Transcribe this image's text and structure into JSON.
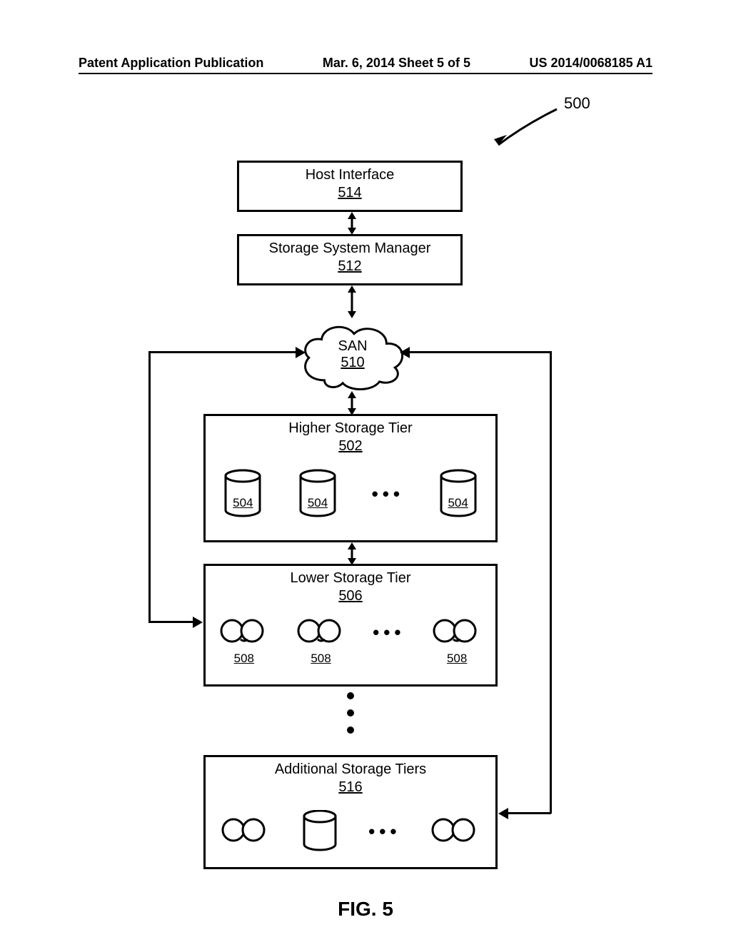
{
  "header": {
    "left": "Patent Application Publication",
    "center": "Mar. 6, 2014  Sheet 5 of 5",
    "right": "US 2014/0068185 A1"
  },
  "figure": {
    "ref": "500",
    "caption": "FIG. 5",
    "host_interface": {
      "title": "Host Interface",
      "ref": "514"
    },
    "storage_system_manager": {
      "title": "Storage System Manager",
      "ref": "512"
    },
    "san": {
      "title": "SAN",
      "ref": "510"
    },
    "higher_tier": {
      "title": "Higher Storage Tier",
      "ref": "502",
      "item_refs": [
        "504",
        "504",
        "504"
      ]
    },
    "lower_tier": {
      "title": "Lower Storage Tier",
      "ref": "506",
      "item_refs": [
        "508",
        "508",
        "508"
      ]
    },
    "additional_tiers": {
      "title": "Additional Storage Tiers",
      "ref": "516"
    }
  }
}
